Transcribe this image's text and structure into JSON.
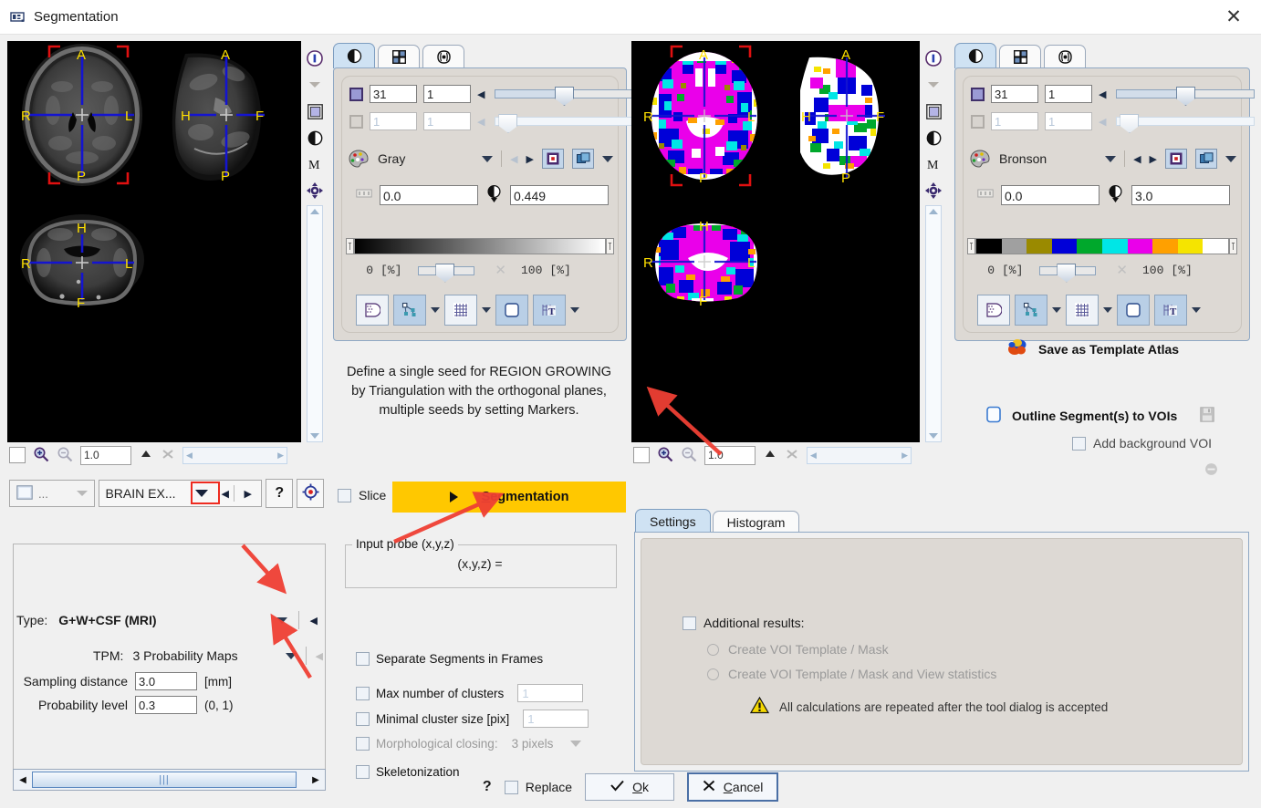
{
  "window": {
    "title": "Segmentation",
    "icon": "segmentation-icon",
    "close_label": "✕"
  },
  "left_view": {
    "icons": [
      "info-icon",
      "chevron-down-icon",
      "layer-color-icon",
      "contrast-icon",
      "m-icon",
      "crosshair-icon"
    ],
    "orientation_labels": [
      "A",
      "R",
      "L",
      "P",
      "H",
      "F"
    ],
    "zoombar": {
      "value": "1.0",
      "zoom_in_icon": "zoom-in-icon",
      "zoom_out_icon": "zoom-out-icon",
      "fit_icon": "fit-icon",
      "reset_icon": "reset-icon"
    }
  },
  "right_view": {
    "icons": [
      "info-icon",
      "chevron-down-icon",
      "layer-color-icon",
      "contrast-icon",
      "m-icon",
      "crosshair-icon"
    ],
    "orientation_labels": [
      "A",
      "R",
      "L",
      "P",
      "H",
      "F"
    ],
    "zoombar": {
      "value": "1.0"
    }
  },
  "color_panel_left": {
    "tabs": [
      {
        "name": "contrast-tab",
        "icon": "contrast-icon",
        "selected": true
      },
      {
        "name": "layout-tab",
        "icon": "layout-grid-icon",
        "selected": false
      },
      {
        "name": "brain-tab",
        "icon": "brain-icon",
        "selected": false
      }
    ],
    "slice_index": "31",
    "slice_total": "1",
    "frame_index": "1",
    "frame_total": "1",
    "lut_name": "Gray",
    "lut_icon": "palette-icon",
    "min_value": "0.0",
    "max_value": "0.449",
    "min_icon": "range-min-icon",
    "max_icon": "threshold-icon",
    "pct_low": "0",
    "pct_high": "100",
    "pct_unit": "[%]",
    "ramp_colors": [
      "#000000",
      "#ffffff"
    ],
    "ramp_type": "gradient",
    "toolbar_icons": [
      "mask-icon",
      "nodes-icon",
      "grid-icon",
      "shape-icon",
      "text-overlay-icon"
    ]
  },
  "color_panel_right": {
    "tabs": [
      {
        "name": "contrast-tab",
        "icon": "contrast-icon",
        "selected": true
      },
      {
        "name": "layout-tab",
        "icon": "layout-grid-icon",
        "selected": false
      },
      {
        "name": "brain-tab",
        "icon": "brain-icon",
        "selected": false
      }
    ],
    "slice_index": "31",
    "slice_total": "1",
    "frame_index": "1",
    "frame_total": "1",
    "lut_name": "Bronson",
    "lut_icon": "palette-icon",
    "min_value": "0.0",
    "max_value": "3.0",
    "pct_low": "0",
    "pct_high": "100",
    "pct_unit": "[%]",
    "ramp_colors": [
      "#000000",
      "#a0a0a0",
      "#9a8a00",
      "#0000d8",
      "#00a82c",
      "#00e6e6",
      "#ea00ea",
      "#ffa000",
      "#f5e400",
      "#ffffff"
    ],
    "ramp_type": "bands",
    "toolbar_icons": [
      "mask-icon",
      "nodes-icon",
      "grid-icon",
      "shape-icon",
      "text-overlay-icon"
    ]
  },
  "left_settings": {
    "series_selector": {
      "icon": "image-swatch-icon",
      "label": "..."
    },
    "protocol": "BRAIN EX...",
    "help_label": "?",
    "target_icon": "target-icon",
    "type_label": "Type:",
    "type_value": "G+W+CSF (MRI)",
    "tpm_label": "TPM:",
    "tpm_value": "3 Probability Maps",
    "sampling_label": "Sampling distance",
    "sampling_value": "3.0",
    "sampling_unit": "[mm]",
    "probability_label": "Probability level",
    "probability_value": "0.3",
    "probability_unit": "(0, 1)"
  },
  "center": {
    "hint_lines": [
      "Define a single seed for REGION GROWING",
      "by Triangulation with the orthogonal planes,",
      "multiple seeds by setting Markers."
    ],
    "slice_checkbox": {
      "label": "Slice",
      "checked": false
    },
    "segmentation_button": {
      "label": "Segmentation",
      "accent": "#ffc800",
      "underline_char": "S"
    },
    "input_probe": {
      "legend": "Input probe (x,y,z)",
      "value": "(x,y,z) ="
    },
    "options": [
      {
        "label": "Separate Segments in Frames",
        "checked": false,
        "field": null
      },
      {
        "label": "Max number of clusters",
        "checked": false,
        "field": "1"
      },
      {
        "label": "Minimal cluster size [pix]",
        "checked": false,
        "field": "1"
      },
      {
        "label": "Morphological closing:",
        "checked": false,
        "dropdown": "3 pixels"
      },
      {
        "label": "Skeletonization",
        "checked": false,
        "field": null
      }
    ]
  },
  "right_actions": {
    "save_atlas": {
      "label": "Save as Template Atlas",
      "icon": "atlas-brain-icon"
    },
    "outline_vois": {
      "label": "Outline Segment(s) to VOIs",
      "icon": "outline-shape-icon",
      "save_icon": "floppy-disk-icon"
    },
    "add_background": {
      "label": "Add background VOI",
      "checked": false
    },
    "minus_icon": "minus-circle-icon"
  },
  "right_settings": {
    "tabs": [
      {
        "label": "Settings",
        "selected": true
      },
      {
        "label": "Histogram",
        "selected": false
      }
    ],
    "additional_results": {
      "label": "Additional results:",
      "checked": false
    },
    "radios": [
      {
        "label": "Create VOI Template / Mask",
        "selected": false
      },
      {
        "label": "Create VOI Template / Mask and View statistics",
        "selected": false
      }
    ],
    "warning": {
      "icon": "warning-icon",
      "text": "All calculations are repeated after the tool dialog is accepted"
    }
  },
  "footer": {
    "help_label": "?",
    "replace": {
      "label": "Replace",
      "checked": false
    },
    "ok": {
      "label": "Ok",
      "icon": "check-icon",
      "underline_char": "O"
    },
    "cancel": {
      "label": "Cancel",
      "icon": "x-icon",
      "underline_char": "C"
    }
  },
  "annotations": {
    "highlight_box": "protocol-dropdown-highlight",
    "arrows": [
      "arrow-to-type-dropdown",
      "arrow-to-tpm-dropdown",
      "arrow-to-segmentation-button",
      "arrow-to-result-image"
    ],
    "arrow_color": "#ef4034"
  }
}
